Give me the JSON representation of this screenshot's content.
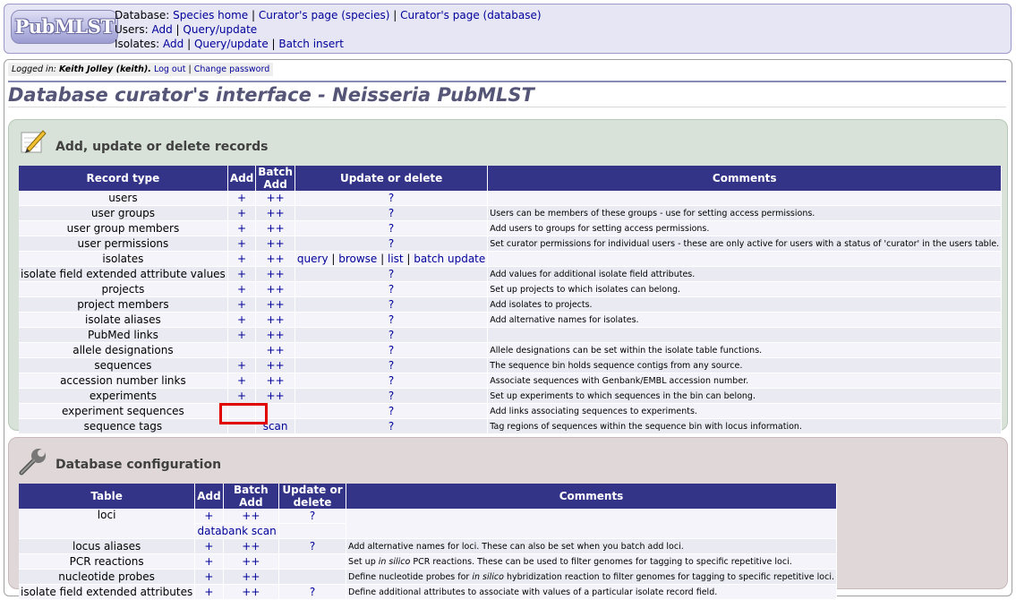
{
  "header": {
    "logo": "PubMLST",
    "database_label": "Database:",
    "database_links": [
      "Species home",
      "Curator's page (species)",
      "Curator's page (database)"
    ],
    "users_label": "Users:",
    "users_links": [
      "Add",
      "Query/update"
    ],
    "isolates_label": "Isolates:",
    "isolates_links": [
      "Add",
      "Query/update",
      "Batch insert"
    ]
  },
  "login": {
    "prefix": "Logged in:",
    "user": "Keith Jolley (keith).",
    "logout": "Log out",
    "change_password": "Change password"
  },
  "title": "Database curator's interface - Neisseria PubMLST",
  "records_section": {
    "heading": "Add, update or delete records",
    "columns": [
      "Record type",
      "Add",
      "Batch Add",
      "Update or delete",
      "Comments"
    ],
    "rows": [
      {
        "type": "users",
        "add": "+",
        "batch": "++",
        "update": "?",
        "comment": ""
      },
      {
        "type": "user groups",
        "add": "+",
        "batch": "++",
        "update": "?",
        "comment": "Users can be members of these groups - use for setting access permissions."
      },
      {
        "type": "user group members",
        "add": "+",
        "batch": "++",
        "update": "?",
        "comment": "Add users to groups for setting access permissions."
      },
      {
        "type": "user permissions",
        "add": "+",
        "batch": "++",
        "update": "?",
        "comment": "Set curator permissions for individual users - these are only active for users with a status of 'curator' in the users table."
      },
      {
        "type": "isolates",
        "add": "+",
        "batch": "++",
        "update": "",
        "comment": ""
      },
      {
        "type": "isolate field extended attribute values",
        "add": "+",
        "batch": "++",
        "update": "?",
        "comment": "Add values for additional isolate field attributes."
      },
      {
        "type": "projects",
        "add": "+",
        "batch": "++",
        "update": "?",
        "comment": "Set up projects to which isolates can belong."
      },
      {
        "type": "project members",
        "add": "+",
        "batch": "++",
        "update": "?",
        "comment": "Add isolates to projects."
      },
      {
        "type": "isolate aliases",
        "add": "+",
        "batch": "++",
        "update": "?",
        "comment": "Add alternative names for isolates."
      },
      {
        "type": "PubMed links",
        "add": "+",
        "batch": "++",
        "update": "?",
        "comment": ""
      },
      {
        "type": "allele designations",
        "add": "",
        "batch": "++",
        "update": "?",
        "comment": "Allele designations can be set within the isolate table functions."
      },
      {
        "type": "sequences",
        "add": "+",
        "batch": "++",
        "update": "?",
        "comment": "The sequence bin holds sequence contigs from any source."
      },
      {
        "type": "accession number links",
        "add": "+",
        "batch": "++",
        "update": "?",
        "comment": "Associate sequences with Genbank/EMBL accession number."
      },
      {
        "type": "experiments",
        "add": "+",
        "batch": "++",
        "update": "?",
        "comment": "Set up experiments to which sequences in the bin can belong."
      },
      {
        "type": "experiment sequences",
        "add": "",
        "batch": "",
        "update": "?",
        "comment": "Add links associating sequences to experiments."
      },
      {
        "type": "sequence tags",
        "add": "",
        "batch": "scan",
        "update": "?",
        "comment": "Tag regions of sequences within the sequence bin with locus information."
      }
    ],
    "isolates_update_links": [
      "query",
      "browse",
      "list",
      "batch update"
    ]
  },
  "config_section": {
    "heading": "Database configuration",
    "columns": [
      "Table",
      "Add",
      "Batch Add",
      "Update or delete",
      "Comments"
    ],
    "loci_row": {
      "type": "loci",
      "add": "+",
      "batch": "++",
      "update": "?",
      "extra_links": [
        "databank",
        "scan"
      ]
    },
    "rows": [
      {
        "type": "locus aliases",
        "add": "+",
        "batch": "++",
        "update": "?",
        "comment": "Add alternative names for loci. These can also be set when you batch add loci."
      },
      {
        "type": "PCR reactions",
        "add": "+",
        "batch": "++",
        "update": "",
        "comment_pre": "Set up ",
        "comment_em": "in silico",
        "comment_post": " PCR reactions. These can be used to filter genomes for tagging to specific repetitive loci."
      },
      {
        "type": "nucleotide probes",
        "add": "+",
        "batch": "++",
        "update": "",
        "comment_pre": "Define nucleotide probes for ",
        "comment_em": "in silico",
        "comment_post": " hybridization reaction to filter genomes for tagging to specific repetitive loci."
      },
      {
        "type": "isolate field extended attributes",
        "add": "+",
        "batch": "++",
        "update": "?",
        "comment": "Define additional attributes to associate with values of a particular isolate record field."
      }
    ]
  },
  "colors": {
    "header_bg": "#e6e6f5",
    "table_header": "#333388",
    "records_box": "#d8e2d8",
    "config_box": "#e0d8d8",
    "link": "#000099",
    "highlight": "#e00000"
  },
  "icons": [
    "notepad-pencil-icon",
    "wrench-icon"
  ]
}
